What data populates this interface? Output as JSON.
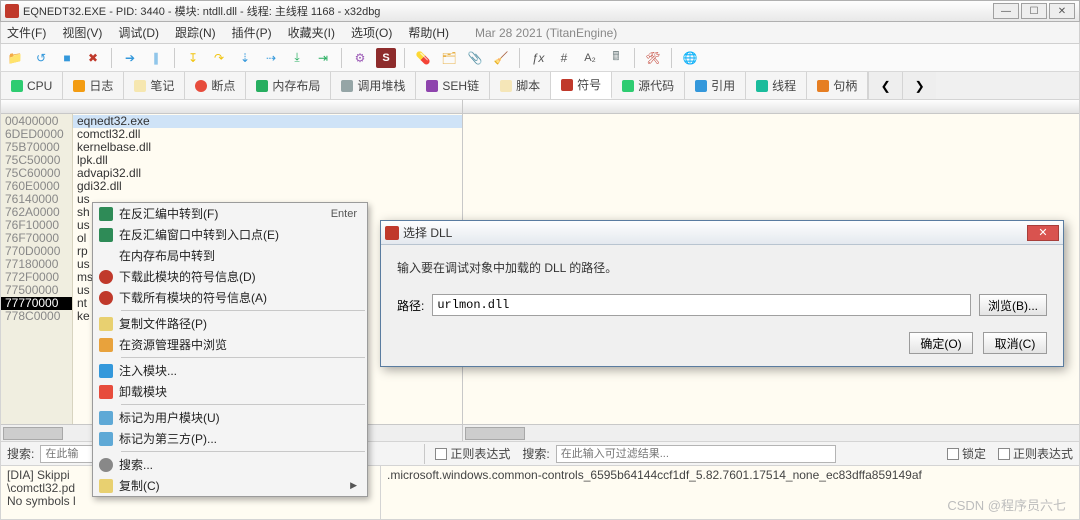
{
  "titlebar": {
    "text": "EQNEDT32.EXE - PID: 3440 - 模块: ntdll.dll - 线程: 主线程 1168 - x32dbg"
  },
  "menu": {
    "file": "文件(F)",
    "view": "视图(V)",
    "debug": "调试(D)",
    "trace": "跟踪(N)",
    "plugins": "插件(P)",
    "favourites": "收藏夹(I)",
    "options": "选项(O)",
    "help": "帮助(H)",
    "engine_date": "Mar 28 2021 (TitanEngine)"
  },
  "tabs": {
    "cpu": "CPU",
    "log": "日志",
    "notes": "笔记",
    "breakpoints": "断点",
    "memmap": "内存布局",
    "callstack": "调用堆栈",
    "seh": "SEH链",
    "script": "脚本",
    "symbols": "符号",
    "source": "源代码",
    "references": "引用",
    "threads": "线程",
    "handles": "句柄"
  },
  "modules": {
    "addrs": [
      "00400000",
      "6DED0000",
      "75B70000",
      "75C50000",
      "75C60000",
      "760E0000",
      "76140000",
      "762A0000",
      "76F10000",
      "76F70000",
      "770D0000",
      "77180000",
      "772F0000",
      "77500000",
      "77770000",
      "778C0000"
    ],
    "selected_idx": 14,
    "names": [
      "eqnedt32.exe",
      "comctl32.dll",
      "kernelbase.dll",
      "lpk.dll",
      "advapi32.dll",
      "gdi32.dll",
      "us",
      "sh",
      "us",
      "ol",
      "rp",
      "us",
      "ms",
      "us",
      "nt",
      "ke"
    ]
  },
  "ctx": {
    "i0": {
      "label": "在反汇编中转到(F)",
      "accel": "Enter"
    },
    "i1": {
      "label": "在反汇编窗口中转到入口点(E)"
    },
    "i2": {
      "label": "在内存布局中转到"
    },
    "i3": {
      "label": "下载此模块的符号信息(D)"
    },
    "i4": {
      "label": "下载所有模块的符号信息(A)"
    },
    "i5": {
      "label": "复制文件路径(P)"
    },
    "i6": {
      "label": "在资源管理器中浏览"
    },
    "i7": {
      "label": "注入模块..."
    },
    "i8": {
      "label": "卸载模块"
    },
    "i9": {
      "label": "标记为用户模块(U)"
    },
    "i10": {
      "label": "标记为第三方(P)..."
    },
    "i11": {
      "label": "搜索..."
    },
    "i12": {
      "label": "复制(C)"
    }
  },
  "dialog": {
    "title": "选择 DLL",
    "message": "输入要在调试对象中加载的 DLL 的路径。",
    "path_label": "路径:",
    "path_value": "urlmon.dll",
    "browse": "浏览(B)...",
    "ok": "确定(O)",
    "cancel": "取消(C)"
  },
  "search": {
    "label_left": "搜索:",
    "placeholder_left": "在此输",
    "regex1": "正则表达式",
    "label_right": "搜索:",
    "placeholder_right": "在此输入可过滤结果...",
    "lock": "锁定",
    "regex2": "正则表达式"
  },
  "log": {
    "l1": "[DIA] Skippi",
    "l2": "\\comctl32.pd",
    "l3": "No symbols l",
    "r1": ".microsoft.windows.common-controls_6595b64144ccf1df_5.82.7601.17514_none_ec83dffa859149af"
  },
  "watermark": "CSDN @程序员六七"
}
